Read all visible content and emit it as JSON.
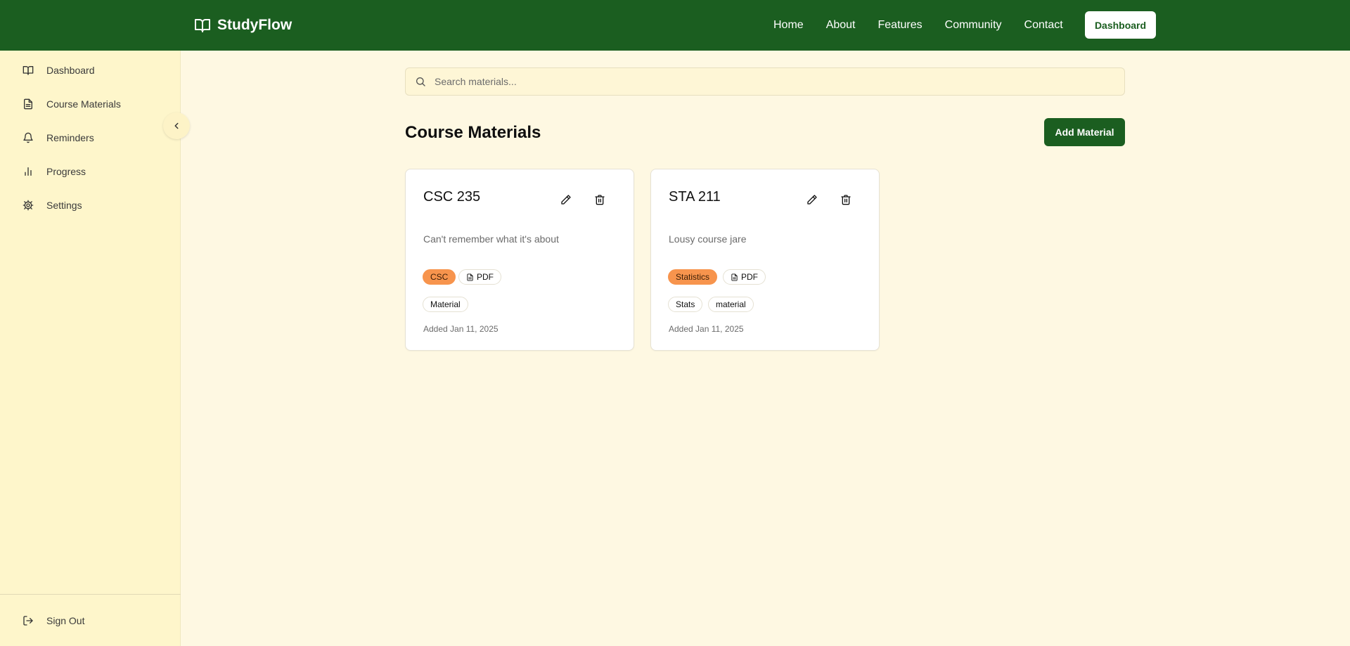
{
  "brand": {
    "name": "StudyFlow",
    "icon": "book-open-icon"
  },
  "nav": {
    "links": [
      "Home",
      "About",
      "Features",
      "Community",
      "Contact"
    ],
    "dashboard_button": "Dashboard"
  },
  "sidebar": {
    "items": [
      {
        "label": "Dashboard",
        "icon": "book-open-icon"
      },
      {
        "label": "Course Materials",
        "icon": "file-text-icon"
      },
      {
        "label": "Reminders",
        "icon": "bell-icon"
      },
      {
        "label": "Progress",
        "icon": "bar-chart-icon"
      },
      {
        "label": "Settings",
        "icon": "gear-icon"
      }
    ],
    "sign_out": {
      "label": "Sign Out",
      "icon": "log-out-icon"
    }
  },
  "search": {
    "placeholder": "Search materials...",
    "value": ""
  },
  "main": {
    "title": "Course Materials",
    "add_button": "Add Material"
  },
  "materials": [
    {
      "title": "CSC 235",
      "description": "Can't remember what it's about",
      "category": "CSC",
      "file_type": "PDF",
      "tags": [
        "Material"
      ],
      "added": "Added Jan 11, 2025"
    },
    {
      "title": "STA 211",
      "description": "Lousy course jare",
      "category": "Statistics",
      "file_type": "PDF",
      "tags": [
        "Stats",
        "material"
      ],
      "added": "Added Jan 11, 2025"
    }
  ],
  "colors": {
    "brand_green": "#1b5e20",
    "page_bg": "#fef8e2",
    "sidebar_bg": "#fef6cb",
    "category_orange": "#f7944d"
  }
}
